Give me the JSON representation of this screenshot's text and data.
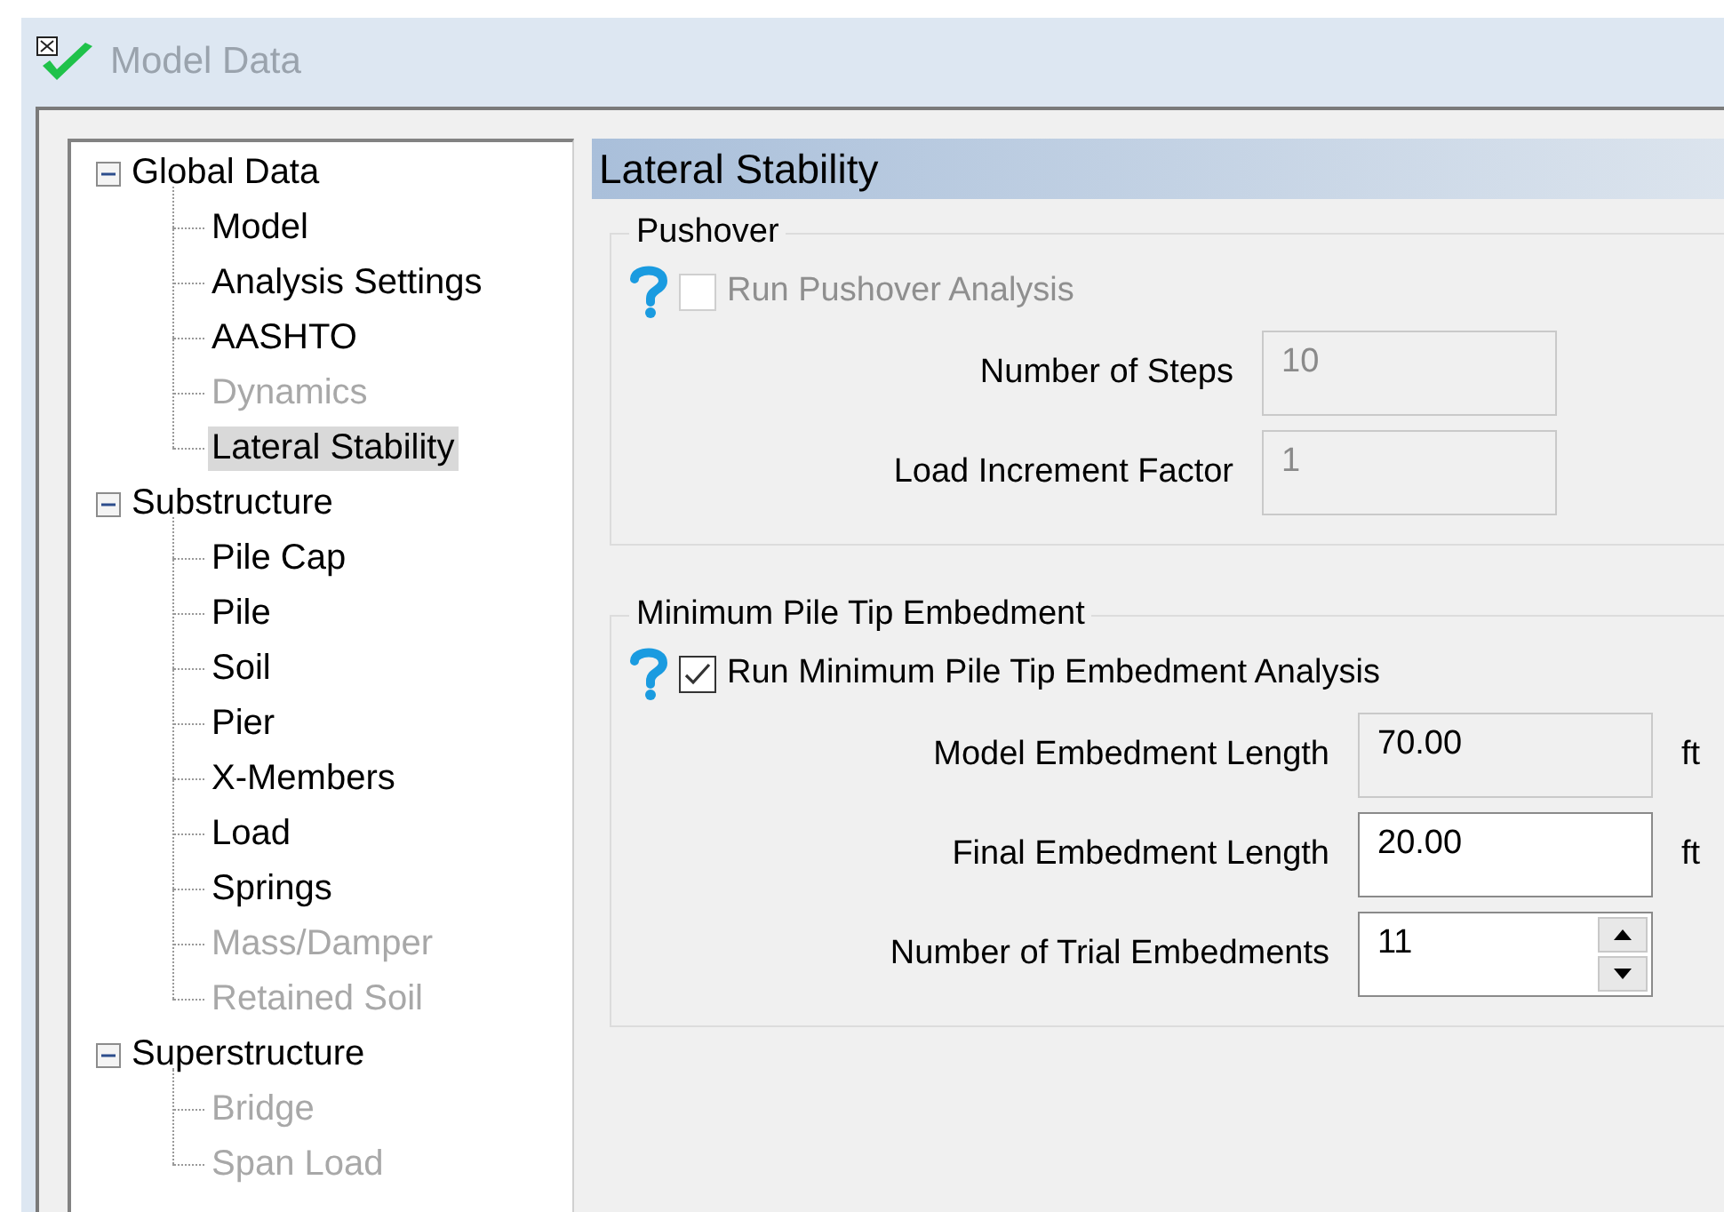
{
  "window": {
    "title": "Model Data"
  },
  "tree": [
    {
      "label": "Global Data",
      "expanded": true,
      "selected": false,
      "children": [
        {
          "label": "Model",
          "disabled": false,
          "selected": false
        },
        {
          "label": "Analysis Settings",
          "disabled": false,
          "selected": false
        },
        {
          "label": "AASHTO",
          "disabled": false,
          "selected": false
        },
        {
          "label": "Dynamics",
          "disabled": true,
          "selected": false
        },
        {
          "label": "Lateral Stability",
          "disabled": false,
          "selected": true
        }
      ]
    },
    {
      "label": "Substructure",
      "expanded": true,
      "selected": false,
      "children": [
        {
          "label": "Pile Cap",
          "disabled": false,
          "selected": false
        },
        {
          "label": "Pile",
          "disabled": false,
          "selected": false
        },
        {
          "label": "Soil",
          "disabled": false,
          "selected": false
        },
        {
          "label": "Pier",
          "disabled": false,
          "selected": false
        },
        {
          "label": "X-Members",
          "disabled": false,
          "selected": false
        },
        {
          "label": "Load",
          "disabled": false,
          "selected": false
        },
        {
          "label": "Springs",
          "disabled": false,
          "selected": false
        },
        {
          "label": "Mass/Damper",
          "disabled": true,
          "selected": false
        },
        {
          "label": "Retained Soil",
          "disabled": true,
          "selected": false
        }
      ]
    },
    {
      "label": "Superstructure",
      "expanded": true,
      "selected": false,
      "children": [
        {
          "label": "Bridge",
          "disabled": true,
          "selected": false
        },
        {
          "label": "Span Load",
          "disabled": true,
          "selected": false
        }
      ]
    }
  ],
  "panel": {
    "title": "Lateral Stability",
    "groups": [
      {
        "title": "Pushover",
        "option": {
          "label": "Run Pushover Analysis",
          "checked": false,
          "disabled": true
        },
        "fields": [
          {
            "kind": "text",
            "label": "Number of Steps",
            "value": "10",
            "disabled": true,
            "read_only": true
          },
          {
            "kind": "text",
            "label": "Load Increment Factor",
            "value": "1",
            "disabled": true,
            "read_only": true
          }
        ]
      },
      {
        "title": "Minimum Pile Tip Embedment",
        "option": {
          "label": "Run Minimum Pile Tip Embedment Analysis",
          "checked": true,
          "disabled": false
        },
        "fields": [
          {
            "kind": "text",
            "label": "Model Embedment Length",
            "value": "70.00",
            "disabled": false,
            "read_only": true,
            "unit": "ft"
          },
          {
            "kind": "text",
            "label": "Final Embedment Length",
            "value": "20.00",
            "disabled": false,
            "read_only": false,
            "unit": "ft"
          },
          {
            "kind": "spinner",
            "label": "Number of Trial Embedments",
            "value": "11",
            "disabled": false,
            "read_only": false
          }
        ]
      }
    ]
  }
}
